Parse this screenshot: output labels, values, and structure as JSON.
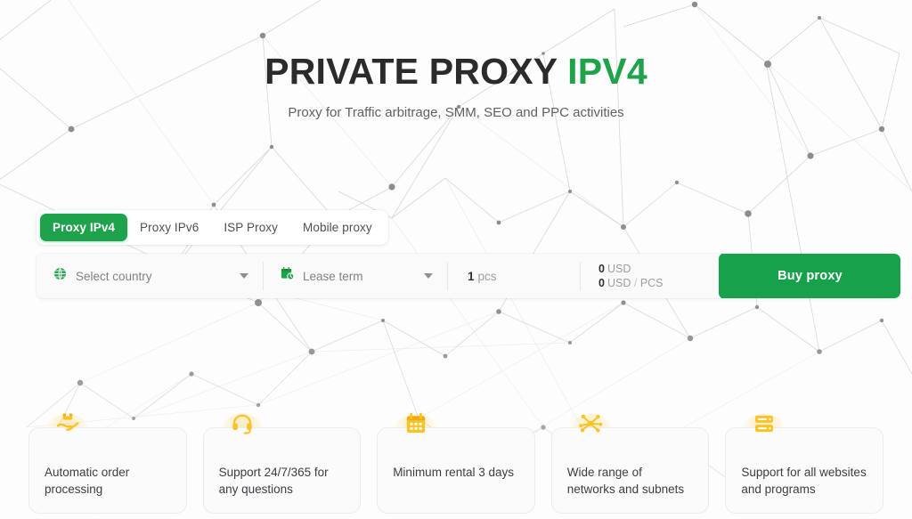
{
  "theme": {
    "brand_green": "#1fa24a",
    "button_green": "#16a14a",
    "icon_yellow": "#fac328",
    "page_background": "#fdfdfd",
    "node_gray": "#8d8d8d"
  },
  "hero": {
    "title_main": "PRIVATE PROXY",
    "title_accent": "IPV4",
    "subtitle": "Proxy for Traffic arbitrage, SMM, SEO and PPC activities"
  },
  "tabs": [
    {
      "label": "Proxy IPv4",
      "active": true,
      "name": "tab-proxy-ipv4"
    },
    {
      "label": "Proxy IPv6",
      "active": false,
      "name": "tab-proxy-ipv6"
    },
    {
      "label": "ISP Proxy",
      "active": false,
      "name": "tab-isp-proxy"
    },
    {
      "label": "Mobile proxy",
      "active": false,
      "name": "tab-mobile-proxy"
    }
  ],
  "order": {
    "country": {
      "placeholder": "Select country",
      "icon": "globe-icon"
    },
    "term": {
      "placeholder": "Lease term",
      "icon": "calendar-clock-icon"
    },
    "quantity": {
      "value": "1",
      "unit": "pcs"
    },
    "price": {
      "total_value": "0",
      "total_currency": "USD",
      "unit_value": "0",
      "unit_currency": "USD",
      "unit_separator": "/",
      "unit_suffix": "PCS"
    },
    "buy_label": "Buy proxy"
  },
  "features": [
    {
      "icon": "hand-package-icon",
      "line1": "Automatic order",
      "line2": "processing"
    },
    {
      "icon": "headset-icon",
      "line1": "Support 24/7/365 for",
      "line2": "any questions"
    },
    {
      "icon": "calendar-icon",
      "line1": "Minimum rental 3 days",
      "line2": ""
    },
    {
      "icon": "network-nodes-icon",
      "line1": "Wide range of",
      "line2": "networks and subnets"
    },
    {
      "icon": "server-stack-icon",
      "line1": "Support for all websites",
      "line2": "and programs"
    }
  ]
}
